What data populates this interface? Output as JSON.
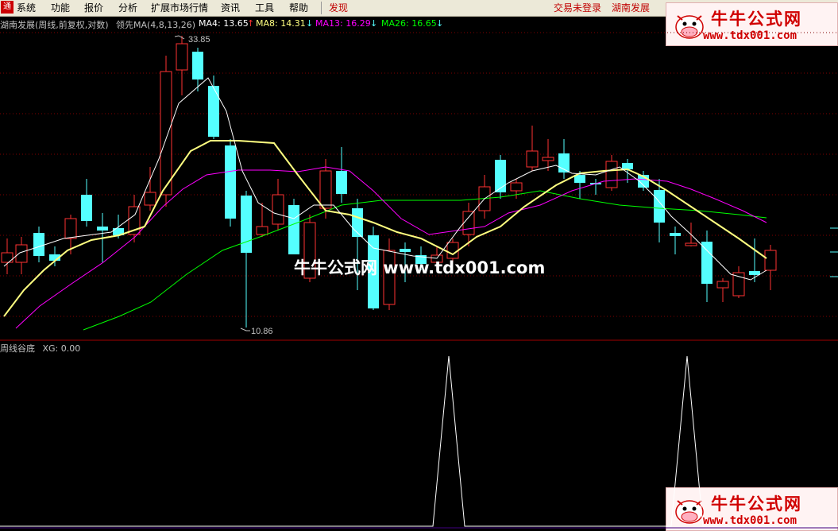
{
  "menubar": {
    "items": [
      {
        "name": "menu-system",
        "label": "系统"
      },
      {
        "name": "menu-function",
        "label": "功能"
      },
      {
        "name": "menu-quote",
        "label": "报价"
      },
      {
        "name": "menu-analysis",
        "label": "分析"
      },
      {
        "name": "menu-extended-market",
        "label": "扩展市场行情"
      },
      {
        "name": "menu-info",
        "label": "资讯"
      },
      {
        "name": "menu-tools",
        "label": "工具"
      },
      {
        "name": "menu-help",
        "label": "帮助"
      },
      {
        "name": "menu-discover",
        "label": "发现"
      }
    ],
    "login_status": "交易未登录",
    "stock_name": "湖南发展"
  },
  "brand": {
    "title": "牛牛公式网",
    "url": "www.tdx001.com",
    "icon": "cow-icon"
  },
  "main_legend": {
    "title": "湖南发展(周线,前复权,对数)",
    "indicator": "领先MA(4,8,13,26)",
    "ma4": "MA4: 13.65",
    "ma8": "MA8: 14.31",
    "ma13": "MA13: 16.29",
    "ma26": "MA26: 16.65",
    "ma4_arrow": "↑",
    "ma8_arrow": "↓",
    "ma13_arrow": "↓",
    "ma26_arrow": "↓"
  },
  "annotations": {
    "high_label": "33.85",
    "low_label": "10.86"
  },
  "sub_legend": {
    "title": "周线谷底",
    "value": "XG: 0.00"
  },
  "watermark": "牛牛公式网 www.tdx001.com",
  "colors": {
    "up": "#ff3232",
    "down": "#54ffff",
    "ma4": "#ffffff",
    "ma8": "#ffff80",
    "ma13": "#ff00ff",
    "ma26": "#00ff00",
    "grid": "#800000",
    "legend_text": "#c0c0c0",
    "brand": "#d00000"
  }
}
